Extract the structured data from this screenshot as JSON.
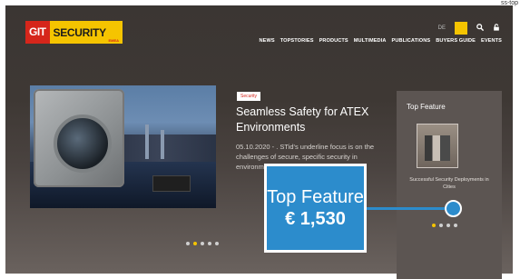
{
  "corner_text": "ss-top",
  "logo": {
    "git": "GIT",
    "security": "SECURITY",
    "region": "EMEA"
  },
  "utility": {
    "language": "DE",
    "search_icon": "search-icon",
    "user_icon": "lock-icon"
  },
  "nav": {
    "items": [
      "NEWS",
      "TOPSTORIES",
      "PRODUCTS",
      "MULTIMEDIA",
      "PUBLICATIONS",
      "BUYERS GUIDE",
      "EVENTS"
    ]
  },
  "slide": {
    "category": "Security",
    "headline": "Seamless Safety for ATEX Environments",
    "teaser": "05.10.2020 - . STid's underline focus is on the challenges of secure, specific security in environments..."
  },
  "side_panel": {
    "title": "Top Feature",
    "caption": "Successful Security Deployments in Cities"
  },
  "callout": {
    "label": "Top Feature",
    "price": "€ 1,530",
    "color": "#2c8ccc"
  },
  "colors": {
    "accent": "#f5c400",
    "brand_red": "#d6261b"
  }
}
